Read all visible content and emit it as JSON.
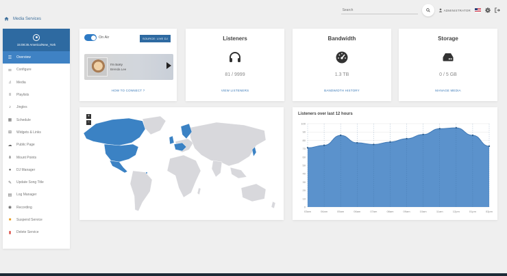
{
  "header": {
    "breadcrumb": "Media Services",
    "search_placeholder": "Search",
    "user_label": "ADMINISTRATOR"
  },
  "sidebar": {
    "timezone": "15:08:35 America/New_York",
    "items": [
      {
        "label": "Overview",
        "icon": "list-icon",
        "active": true
      },
      {
        "label": "Configure",
        "icon": "sliders-icon"
      },
      {
        "label": "Media",
        "icon": "music-note-icon"
      },
      {
        "label": "Playlists",
        "icon": "playlist-icon"
      },
      {
        "label": "Jingles",
        "icon": "bell-icon"
      },
      {
        "label": "Schedule",
        "icon": "calendar-icon"
      },
      {
        "label": "Widgets & Links",
        "icon": "grid-icon"
      },
      {
        "label": "Public Page",
        "icon": "cloud-icon"
      },
      {
        "label": "Mount Points",
        "icon": "sitemap-icon"
      },
      {
        "label": "DJ Manager",
        "icon": "microphone-icon"
      },
      {
        "label": "Update Song Title",
        "icon": "edit-icon"
      },
      {
        "label": "Log Manager",
        "icon": "file-icon"
      },
      {
        "label": "Recording",
        "icon": "record-icon"
      },
      {
        "label": "Suspend Service",
        "icon": "lock-icon",
        "danger": true
      },
      {
        "label": "Delete Service",
        "icon": "trash-icon",
        "danger": true
      }
    ]
  },
  "player": {
    "on_air_label": "On Air",
    "source_button": "SOURCE: LIVE DJ",
    "track_title": "I'm Sorry",
    "track_artist": "Brenda Lee",
    "link": "HOW TO CONNECT ?"
  },
  "stats": [
    {
      "title": "Listeners",
      "value": "81 / 9999",
      "link": "VIEW LISTENERS",
      "icon": "headphones-icon"
    },
    {
      "title": "Bandwidth",
      "value": "1.3 TB",
      "link": "BANDWIDTH HISTORY",
      "icon": "speedometer-icon"
    },
    {
      "title": "Storage",
      "value": "0 / 5 GB",
      "link": "MANAGE MEDIA",
      "icon": "hdd-icon"
    }
  ],
  "map": {
    "zoom_in": "+",
    "zoom_out": "−",
    "highlight_color": "#3b82c4",
    "land_color": "#d8d8dc"
  },
  "chart_data": {
    "type": "area",
    "title": "Listeners over last 12 hours",
    "x": [
      "03am",
      "04am",
      "05am",
      "06am",
      "07am",
      "08am",
      "09am",
      "10am",
      "11am",
      "12pm",
      "01pm",
      "02pm"
    ],
    "values": [
      71,
      74,
      86,
      77,
      75,
      78,
      82,
      87,
      94,
      95,
      86,
      73
    ],
    "ylim": [
      0,
      100
    ],
    "yticks": [
      0,
      10,
      20,
      30,
      40,
      50,
      60,
      70,
      80,
      90,
      100
    ],
    "color": "#5b92cc",
    "grid": true
  }
}
